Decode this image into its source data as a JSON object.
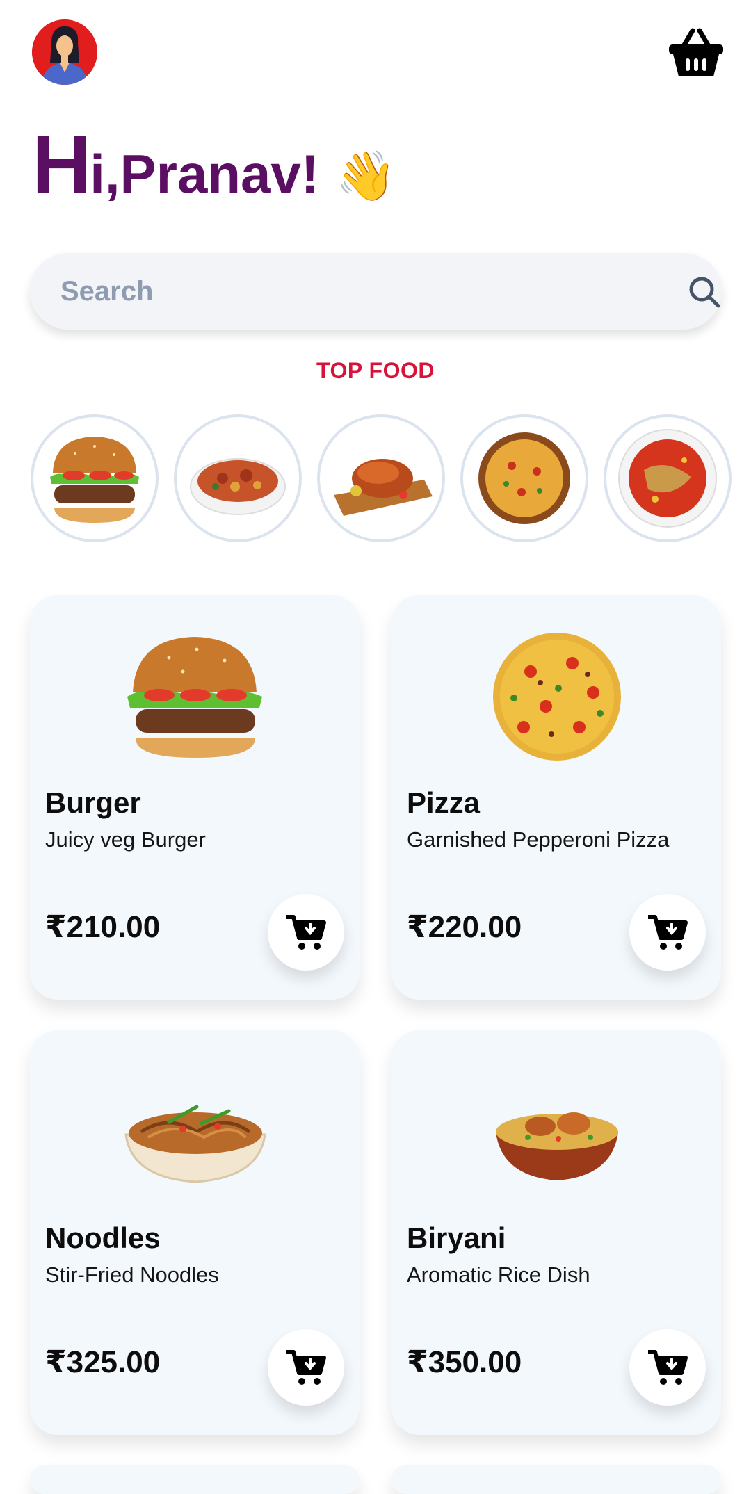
{
  "header": {
    "greeting_big": "H",
    "greeting_rest": "i,Pranav!",
    "greeting_emoji": "👋",
    "avatar_icon": "user-avatar-icon",
    "cart_icon": "basket-icon"
  },
  "search": {
    "placeholder": "Search",
    "icon": "search-icon"
  },
  "top_food": {
    "title": "TOP FOOD",
    "items": [
      "burger",
      "pasta",
      "roast-chicken",
      "pizza",
      "curry"
    ]
  },
  "products": [
    {
      "name": "Burger",
      "description": "Juicy veg Burger",
      "price": "₹210.00"
    },
    {
      "name": "Pizza",
      "description": "Garnished Pepperoni Pizza",
      "price": "₹220.00"
    },
    {
      "name": "Noodles",
      "description": "Stir-Fried Noodles",
      "price": "₹325.00"
    },
    {
      "name": "Biryani",
      "description": "Aromatic Rice Dish",
      "price": "₹350.00"
    }
  ],
  "colors": {
    "accent": "#5b0f63",
    "section_title": "#d6143a",
    "card_bg": "#f3f8fd",
    "search_bg": "#f2f4f7"
  }
}
